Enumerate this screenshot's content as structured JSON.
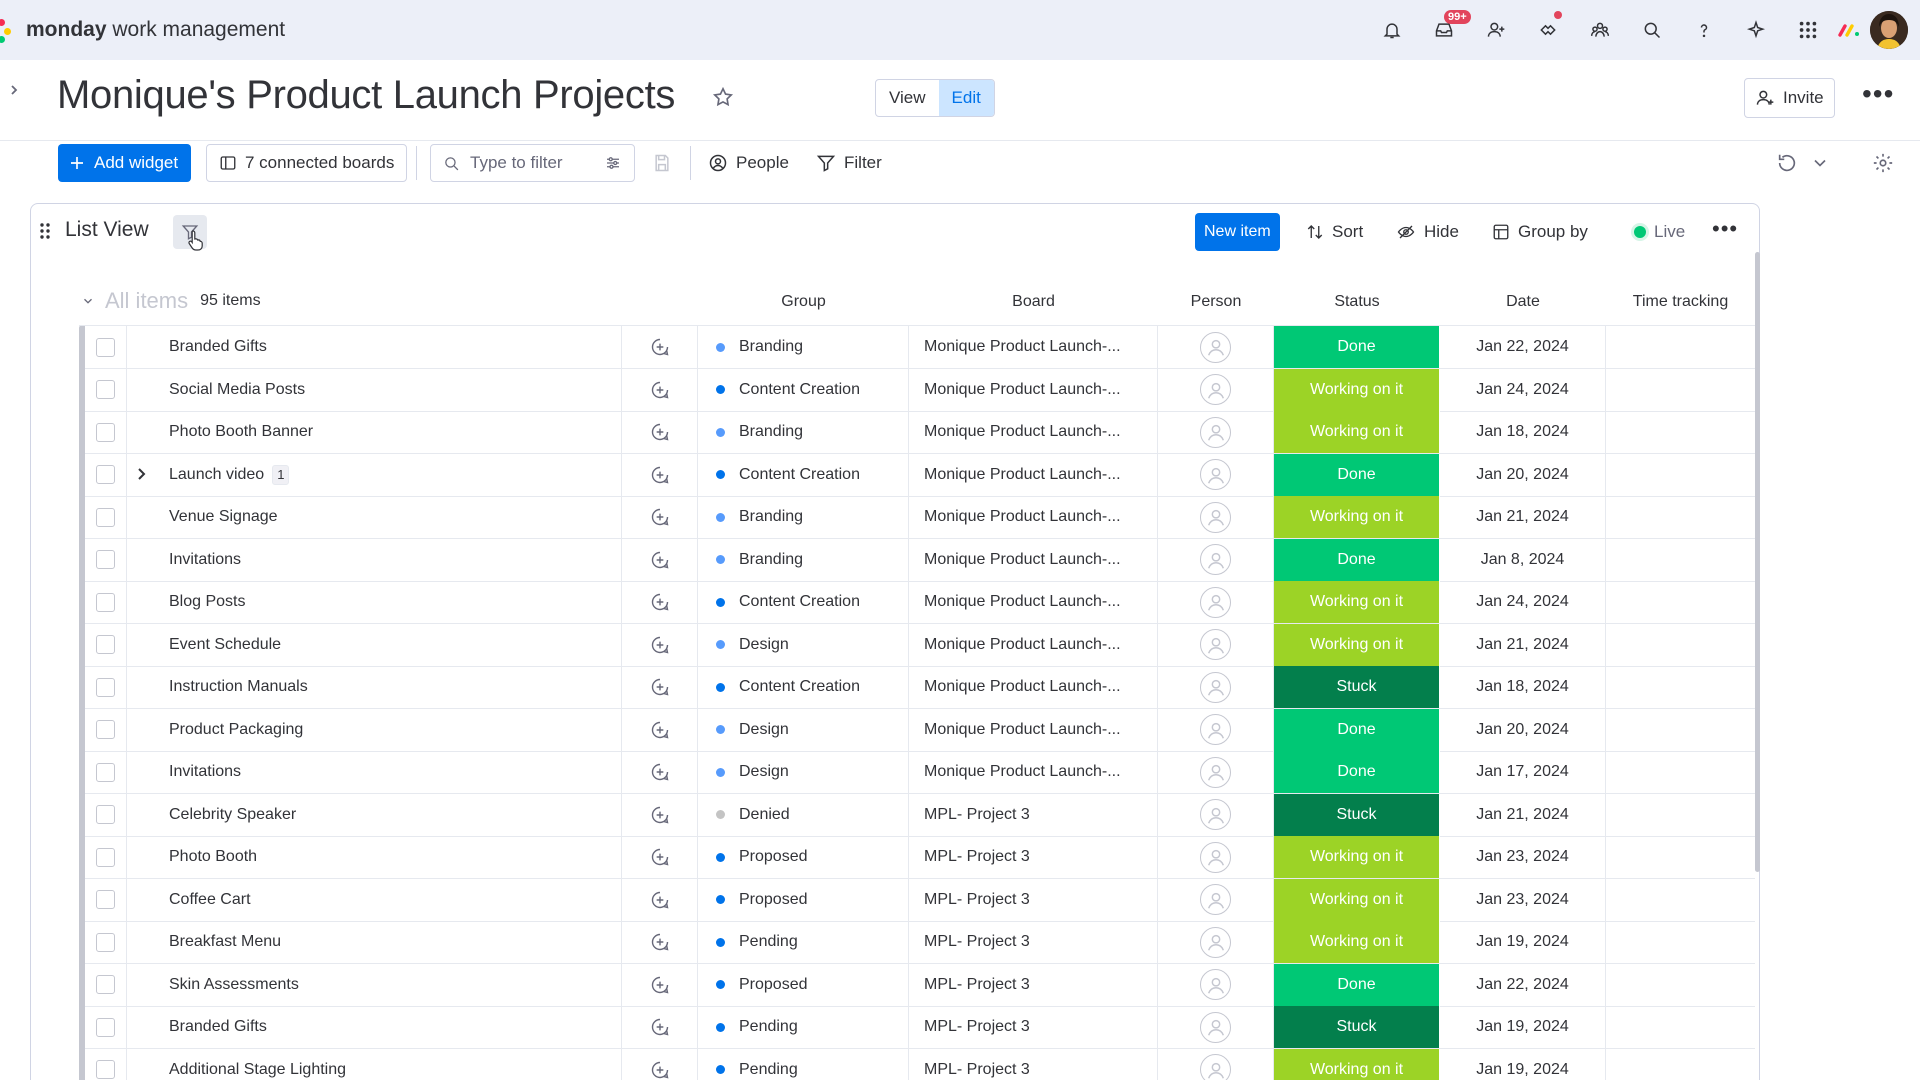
{
  "app": {
    "brand_bold": "monday",
    "brand_rest": " work management",
    "notifications_badge": "99+",
    "colors": {
      "accent": "#0073ea",
      "done": "#00c875",
      "working": "#9cd326",
      "stuck": "#037f4c"
    }
  },
  "board": {
    "title": "Monique's Product Launch Projects",
    "view_label": "View",
    "edit_label": "Edit",
    "invite_label": "Invite"
  },
  "toolbar": {
    "add_widget_label": "Add widget",
    "connected_boards_label": "7 connected boards",
    "filter_placeholder": "Type to filter",
    "people_label": "People",
    "filter_label": "Filter"
  },
  "widget": {
    "title": "List View",
    "new_item_label": "New item",
    "sort_label": "Sort",
    "hide_label": "Hide",
    "group_by_label": "Group by",
    "live_label": "Live"
  },
  "table": {
    "group_title": "All items",
    "group_count": "95 items",
    "columns": {
      "group": "Group",
      "board": "Board",
      "person": "Person",
      "status": "Status",
      "date": "Date",
      "time_tracking": "Time tracking"
    },
    "rows": [
      {
        "name": "Branded Gifts",
        "group": "Branding",
        "group_color": "#579bfc",
        "board": "Monique Product Launch-...",
        "status": "Done",
        "status_color": "#00c875",
        "date": "Jan 22, 2024"
      },
      {
        "name": "Social Media Posts",
        "group": "Content Creation",
        "group_color": "#0073ea",
        "board": "Monique Product Launch-...",
        "status": "Working on it",
        "status_color": "#9cd326",
        "date": "Jan 24, 2024"
      },
      {
        "name": "Photo Booth Banner",
        "group": "Branding",
        "group_color": "#579bfc",
        "board": "Monique Product Launch-...",
        "status": "Working on it",
        "status_color": "#9cd326",
        "date": "Jan 18, 2024"
      },
      {
        "name": "Launch video",
        "subitems": "1",
        "group": "Content Creation",
        "group_color": "#0073ea",
        "board": "Monique Product Launch-...",
        "status": "Done",
        "status_color": "#00c875",
        "date": "Jan 20, 2024"
      },
      {
        "name": "Venue Signage",
        "group": "Branding",
        "group_color": "#579bfc",
        "board": "Monique Product Launch-...",
        "status": "Working on it",
        "status_color": "#9cd326",
        "date": "Jan 21, 2024"
      },
      {
        "name": "Invitations",
        "group": "Branding",
        "group_color": "#579bfc",
        "board": "Monique Product Launch-...",
        "status": "Done",
        "status_color": "#00c875",
        "date": "Jan 8, 2024"
      },
      {
        "name": "Blog Posts",
        "group": "Content Creation",
        "group_color": "#0073ea",
        "board": "Monique Product Launch-...",
        "status": "Working on it",
        "status_color": "#9cd326",
        "date": "Jan 24, 2024"
      },
      {
        "name": "Event Schedule",
        "group": "Design",
        "group_color": "#579bfc",
        "board": "Monique Product Launch-...",
        "status": "Working on it",
        "status_color": "#9cd326",
        "date": "Jan 21, 2024"
      },
      {
        "name": "Instruction Manuals",
        "group": "Content Creation",
        "group_color": "#0073ea",
        "board": "Monique Product Launch-...",
        "status": "Stuck",
        "status_color": "#037f4c",
        "date": "Jan 18, 2024"
      },
      {
        "name": "Product Packaging",
        "group": "Design",
        "group_color": "#579bfc",
        "board": "Monique Product Launch-...",
        "status": "Done",
        "status_color": "#00c875",
        "date": "Jan 20, 2024"
      },
      {
        "name": "Invitations",
        "group": "Design",
        "group_color": "#579bfc",
        "board": "Monique Product Launch-...",
        "status": "Done",
        "status_color": "#00c875",
        "date": "Jan 17, 2024"
      },
      {
        "name": "Celebrity Speaker",
        "group": "Denied",
        "group_color": "#c4c4c4",
        "board": "MPL- Project 3",
        "status": "Stuck",
        "status_color": "#037f4c",
        "date": "Jan 21, 2024"
      },
      {
        "name": "Photo Booth",
        "group": "Proposed",
        "group_color": "#0073ea",
        "board": "MPL- Project 3",
        "status": "Working on it",
        "status_color": "#9cd326",
        "date": "Jan 23, 2024"
      },
      {
        "name": "Coffee Cart",
        "group": "Proposed",
        "group_color": "#0073ea",
        "board": "MPL- Project 3",
        "status": "Working on it",
        "status_color": "#9cd326",
        "date": "Jan 23, 2024"
      },
      {
        "name": "Breakfast Menu",
        "group": "Pending",
        "group_color": "#0073ea",
        "board": "MPL- Project 3",
        "status": "Working on it",
        "status_color": "#9cd326",
        "date": "Jan 19, 2024"
      },
      {
        "name": "Skin Assessments",
        "group": "Proposed",
        "group_color": "#0073ea",
        "board": "MPL- Project 3",
        "status": "Done",
        "status_color": "#00c875",
        "date": "Jan 22, 2024"
      },
      {
        "name": "Branded Gifts",
        "group": "Pending",
        "group_color": "#0073ea",
        "board": "MPL- Project 3",
        "status": "Stuck",
        "status_color": "#037f4c",
        "date": "Jan 19, 2024"
      },
      {
        "name": "Additional Stage Lighting",
        "group": "Pending",
        "group_color": "#0073ea",
        "board": "MPL- Project 3",
        "status": "Working on it",
        "status_color": "#9cd326",
        "date": "Jan 19, 2024"
      }
    ]
  }
}
